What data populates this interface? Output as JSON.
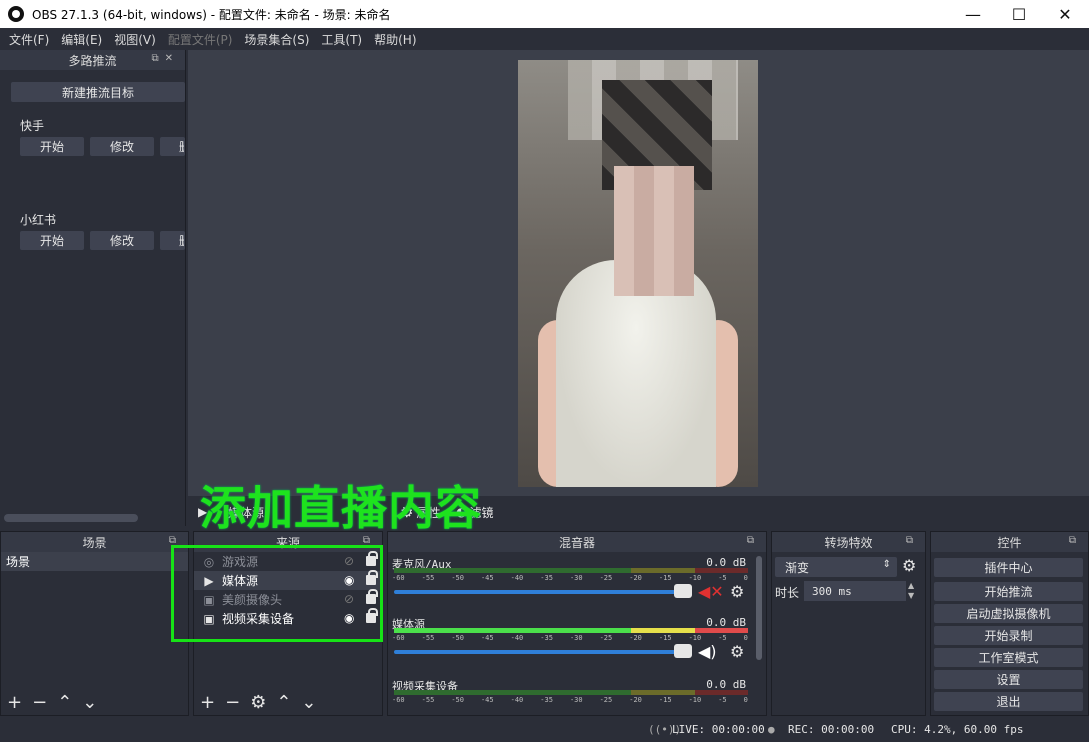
{
  "window": {
    "title": "OBS 27.1.3 (64-bit, windows) - 配置文件: 未命名 - 场景: 未命名",
    "minimize": "—",
    "maximize": "☐",
    "close": "✕"
  },
  "menu": {
    "items": [
      "文件(F)",
      "编辑(E)",
      "视图(V)",
      "配置文件(P)",
      "场景集合(S)",
      "工具(T)",
      "帮助(H)"
    ]
  },
  "multistream": {
    "title": "多路推流",
    "new_target": "新建推流目标",
    "platforms": [
      {
        "name": "快手",
        "start": "开始",
        "edit": "修改",
        "more": "删"
      },
      {
        "name": "小红书",
        "start": "开始",
        "edit": "修改",
        "more": "删"
      }
    ]
  },
  "preview_toolbar": {
    "source_label": "媒体源",
    "properties": "属性",
    "filters": "滤镜"
  },
  "overlay_caption": "添加直播内容",
  "scenes": {
    "title": "场景",
    "items": [
      "场景"
    ]
  },
  "sources": {
    "title": "来源",
    "items": [
      {
        "name": "游戏源",
        "icon": "gamepad-icon",
        "visible": false
      },
      {
        "name": "媒体源",
        "icon": "play-icon",
        "visible": true
      },
      {
        "name": "美颜摄像头",
        "icon": "camera-icon",
        "visible": false
      },
      {
        "name": "视频采集设备",
        "icon": "camera-icon",
        "visible": true
      }
    ]
  },
  "mixer": {
    "title": "混音器",
    "channels": [
      {
        "name": "麦克风/Aux",
        "db": "0.0 dB",
        "muted": true
      },
      {
        "name": "媒体源",
        "db": "0.0 dB",
        "muted": false
      },
      {
        "name": "视频采集设备",
        "db": "0.0 dB",
        "muted": false
      }
    ],
    "ticks": [
      "-60",
      "-55",
      "-50",
      "-45",
      "-40",
      "-35",
      "-30",
      "-25",
      "-20",
      "-15",
      "-10",
      "-5",
      "0"
    ]
  },
  "transitions": {
    "title": "转场特效",
    "selected": "渐变",
    "duration_label": "时长",
    "duration_value": "300 ms"
  },
  "controls": {
    "title": "控件",
    "buttons": [
      "插件中心",
      "开始推流",
      "启动虚拟摄像机",
      "开始录制",
      "工作室模式",
      "设置",
      "退出"
    ]
  },
  "status": {
    "live": "LIVE: 00:00:00",
    "rec": "REC: 00:00:00",
    "cpu": "CPU: 4.2%, 60.00 fps"
  }
}
